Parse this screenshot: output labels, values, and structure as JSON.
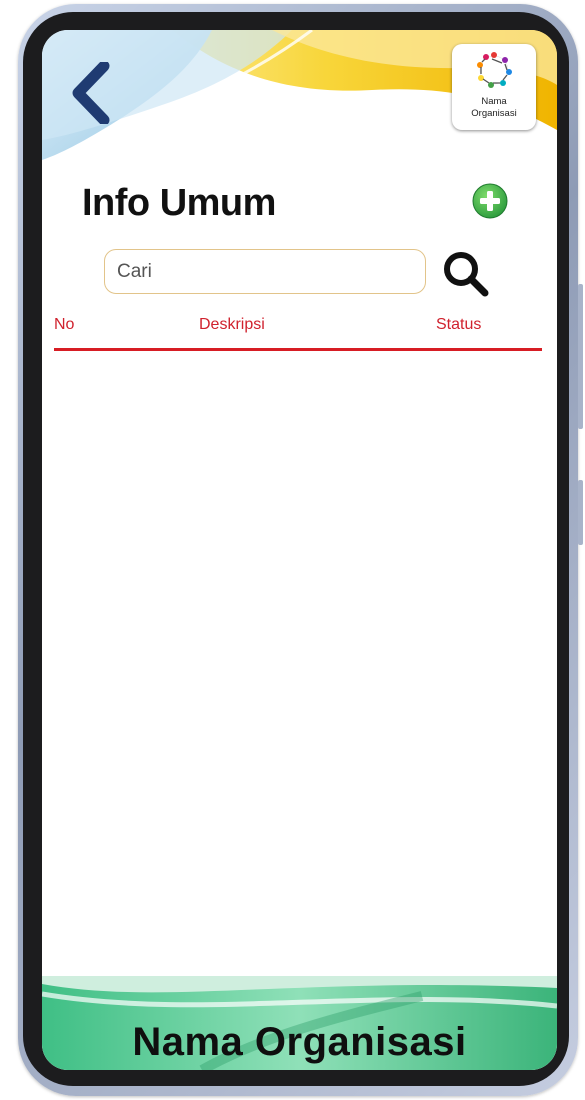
{
  "header": {
    "back_icon": "chevron-left-icon",
    "logo_text_line1": "Nama",
    "logo_text_line2": "Organisasi"
  },
  "page": {
    "title": "Info Umum",
    "add_icon": "plus-circle-icon"
  },
  "search": {
    "placeholder": "Cari",
    "value": "",
    "icon": "search-icon"
  },
  "table": {
    "columns": [
      "No",
      "Deskripsi",
      "Status"
    ],
    "rows": []
  },
  "footer": {
    "title": "Nama Organisasi"
  },
  "colors": {
    "accent_red": "#d71d24",
    "header_yellow": "#f6c71a",
    "header_blue": "#7bb8dc",
    "footer_green": "#49c08a",
    "add_green": "#3bb44a",
    "back_navy": "#1f3b72"
  }
}
